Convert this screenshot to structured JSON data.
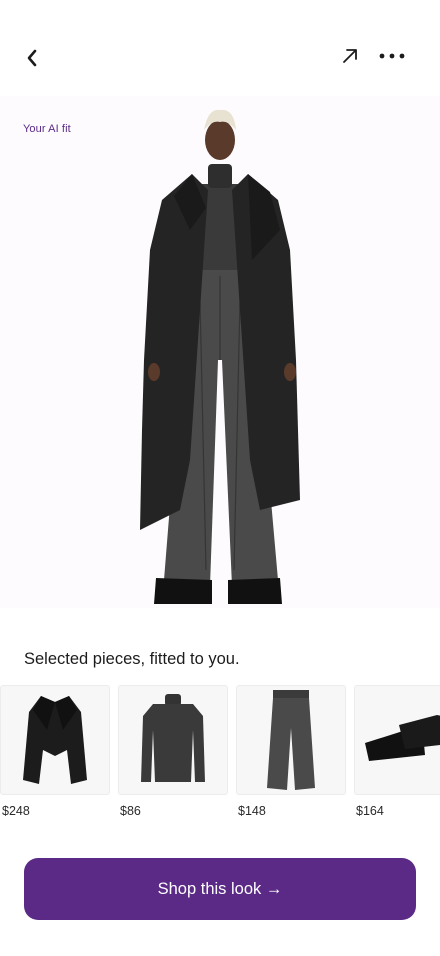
{
  "header": {
    "back_icon": "chevron-left-icon",
    "share_icon": "arrow-up-right-icon",
    "more_icon": "ellipsis-icon"
  },
  "fit": {
    "label": "Your AI fit"
  },
  "caption": "Selected pieces, fitted to you.",
  "pieces": [
    {
      "item": "coat",
      "price": "$248"
    },
    {
      "item": "turtleneck",
      "price": "$86"
    },
    {
      "item": "trousers",
      "price": "$148"
    },
    {
      "item": "loafers",
      "price": "$164"
    }
  ],
  "cta": {
    "label": "Shop this look →"
  },
  "colors": {
    "accent": "#5b2a86",
    "panel_background": "#fdfbfe",
    "thumb_background": "#f7f7f7"
  }
}
